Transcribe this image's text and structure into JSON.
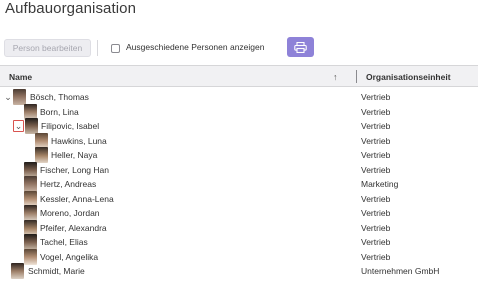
{
  "page": {
    "title": "Aufbauorganisation"
  },
  "toolbar": {
    "edit_person_label": "Person bearbeiten",
    "show_retired_label": "Ausgeschiedene Personen anzeigen",
    "print_icon": "printer-icon"
  },
  "grid": {
    "columns": {
      "name": "Name",
      "org_unit": "Organisationseinheit"
    },
    "sort_icon": "arrow-up-icon",
    "rows": [
      {
        "name": "Bösch, Thomas",
        "org": "Vertrieb",
        "level": 0,
        "expander": "expanded"
      },
      {
        "name": "Born, Lina",
        "org": "Vertrieb",
        "level": 1
      },
      {
        "name": "Filipovic, Isabel",
        "org": "Vertrieb",
        "level": 1,
        "expander": "expanded-focused"
      },
      {
        "name": "Hawkins, Luna",
        "org": "Vertrieb",
        "level": 2
      },
      {
        "name": "Heller, Naya",
        "org": "Vertrieb",
        "level": 2
      },
      {
        "name": "Fischer, Long Han",
        "org": "Vertrieb",
        "level": 1
      },
      {
        "name": "Hertz, Andreas",
        "org": "Marketing",
        "level": 1
      },
      {
        "name": "Kessler, Anna-Lena",
        "org": "Vertrieb",
        "level": 1
      },
      {
        "name": "Moreno, Jordan",
        "org": "Vertrieb",
        "level": 1
      },
      {
        "name": "Pfeifer, Alexandra",
        "org": "Vertrieb",
        "level": 1
      },
      {
        "name": "Tachel, Elias",
        "org": "Vertrieb",
        "level": 1
      },
      {
        "name": "Vogel, Angelika",
        "org": "Vertrieb",
        "level": 1
      },
      {
        "name": "Schmidt, Marie",
        "org": "Unternehmen GmbH",
        "level": 0
      }
    ]
  }
}
